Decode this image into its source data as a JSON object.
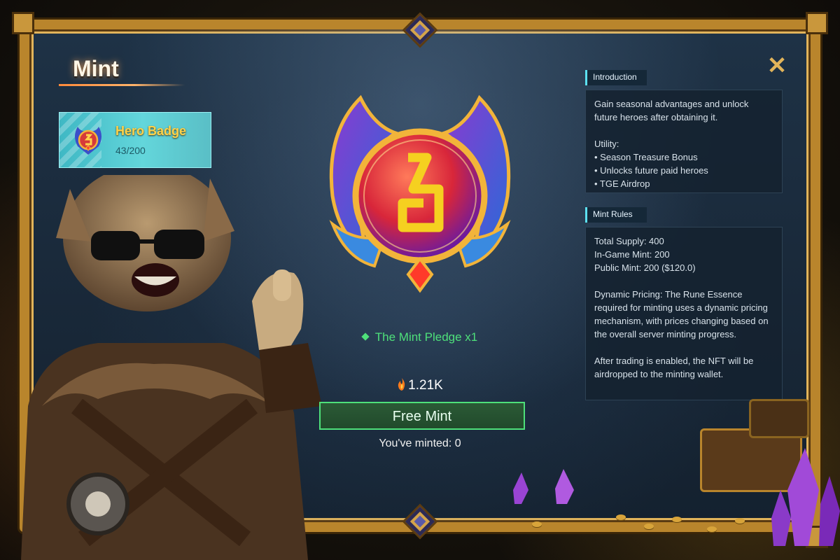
{
  "header": {
    "title": "Mint",
    "close_icon": "close-icon"
  },
  "badge_card": {
    "name": "Hero Badge",
    "count": "43/200",
    "icon": "hero-badge-icon"
  },
  "item": {
    "pledge": "The Mint Pledge x1",
    "price": "1.21K",
    "price_icon": "rune-flame-icon",
    "mint_button": "Free Mint",
    "minted": "You've minted: 0"
  },
  "introduction": {
    "title": "Introduction",
    "description": "Gain seasonal advantages and unlock future heroes after obtaining it.",
    "utility_label": "Utility:",
    "utilities": [
      "• Season Treasure Bonus",
      "• Unlocks future paid heroes",
      "• TGE Airdrop"
    ]
  },
  "mint_rules": {
    "title": "Mint Rules",
    "supply_lines": [
      "Total Supply: 400",
      "In-Game Mint: 200",
      "Public Mint: 200 ($120.0)"
    ],
    "dynamic_pricing": "Dynamic Pricing: The Rune Essence required for minting uses a dynamic pricing mechanism, with prices changing based on the overall server minting progress.",
    "airdrop_note": "After trading is enabled, the NFT will be airdropped to the minting wallet."
  },
  "colors": {
    "frame_gold": "#b9852c",
    "accent_green": "#4ee07a",
    "accent_cyan": "#5ce0f0",
    "badge_gold": "#ffd24a"
  }
}
